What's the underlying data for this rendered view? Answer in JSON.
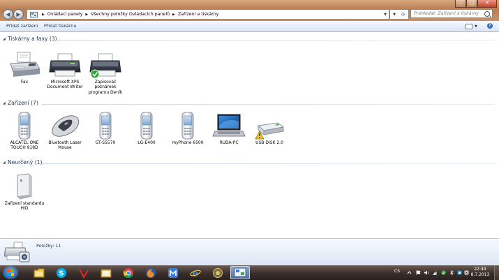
{
  "address": {
    "breadcrumbs": [
      "Ovládací panely",
      "Všechny položky Ovládacích panelů",
      "Zařízení a tiskárny"
    ],
    "search_placeholder": "Prohledat: Zařízení a tiskárny"
  },
  "toolbar": {
    "add_device": "Přidat zařízení",
    "add_printer": "Přidat tiskárnu"
  },
  "groups": {
    "printers": {
      "title": "Tiskárny a faxy (3)",
      "items": [
        {
          "label": "Fax",
          "icon": "fax-icon"
        },
        {
          "label": "Microsoft XPS Document Writer",
          "icon": "printer-icon"
        },
        {
          "label": "Zapisovač poznámek programu Deník",
          "icon": "printer-default-icon"
        }
      ]
    },
    "devices": {
      "title": "Zařízení (7)",
      "items": [
        {
          "label": "ALCATEL ONE TOUCH 918D",
          "icon": "mobile-phone-icon"
        },
        {
          "label": "Bluetooth Laser Mouse",
          "icon": "mouse-icon"
        },
        {
          "label": "GT-S5570",
          "icon": "mobile-phone-icon"
        },
        {
          "label": "LG-E400",
          "icon": "mobile-phone-icon"
        },
        {
          "label": "myPhone 6500",
          "icon": "mobile-phone-icon"
        },
        {
          "label": "RUDA-PC",
          "icon": "laptop-icon"
        },
        {
          "label": "USB DISK 2.0",
          "icon": "usb-drive-warning-icon"
        }
      ]
    },
    "unspecified": {
      "title": "Neurčený (1)",
      "items": [
        {
          "label": "Zařízení standardu HID",
          "icon": "hid-device-icon"
        }
      ]
    }
  },
  "details": {
    "count": "Položky: 11"
  },
  "taskbar": {
    "language": "CS",
    "time": "22:49",
    "date": "8.7.2013",
    "apps": [
      "explorer-folder-icon",
      "skype-icon",
      "app-red-icon",
      "folder-icon",
      "chrome-icon",
      "firefox-icon",
      "maxthon-icon",
      "internet-explorer-icon",
      "app-icon",
      "control-panel-icon"
    ]
  },
  "colors": {
    "title_bar": "#c08a62",
    "group_title": "#1e395b",
    "details_bar": "#dce7f5",
    "taskbar": "#3a2e2a"
  }
}
